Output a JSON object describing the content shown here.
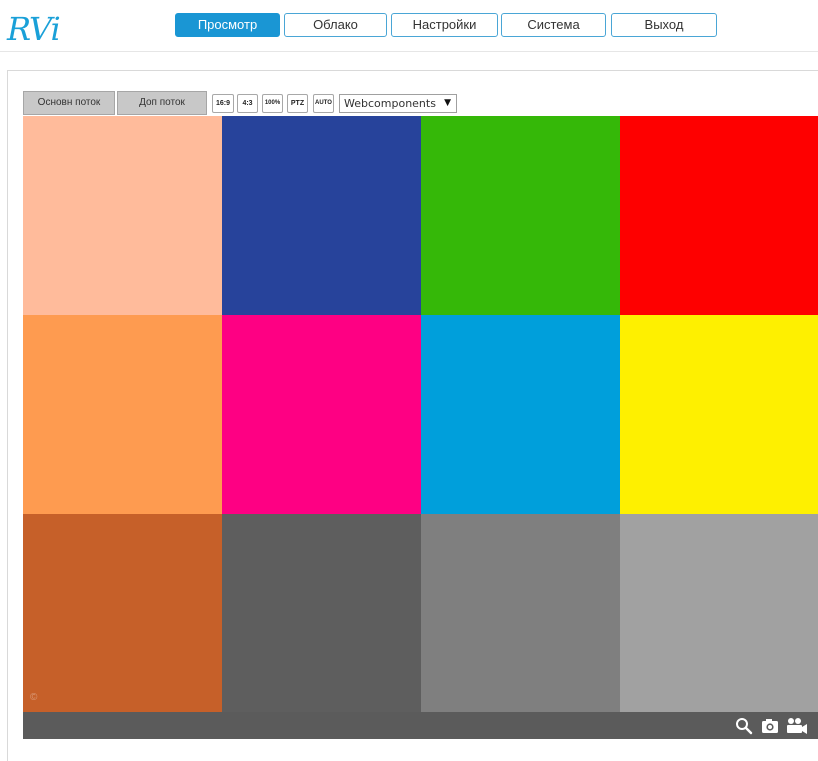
{
  "brand": {
    "logo_text": "RVi"
  },
  "nav": {
    "items": [
      {
        "label": "Просмотр",
        "active": true
      },
      {
        "label": "Облако",
        "active": false
      },
      {
        "label": "Настройки",
        "active": false
      },
      {
        "label": "Система",
        "active": false
      },
      {
        "label": "Выход",
        "active": false
      }
    ]
  },
  "toolbar": {
    "main_stream": "Основн поток",
    "sub_stream": "Доп поток",
    "ratio_16_9": "16:9",
    "ratio_4_3": "4:3",
    "zoom_100": "100%",
    "ptz": "PTZ",
    "auto": "AUTO",
    "player_select": {
      "value": "Webcomponents",
      "arrow": "▼"
    }
  },
  "video": {
    "watermark": "©",
    "colors": [
      "#ffbb9b",
      "#27439b",
      "#35b808",
      "#fe0000",
      "#fe9b50",
      "#fe0083",
      "#009fdb",
      "#fef000",
      "#c66029",
      "#5e5e5e",
      "#7f7f7f",
      "#a1a1a1"
    ]
  },
  "controls": {
    "icons": [
      "search-icon",
      "camera-icon",
      "video-record-icon"
    ]
  },
  "theme": {
    "accent": "#1a96d4",
    "control_bar": "#5b5b5b"
  }
}
